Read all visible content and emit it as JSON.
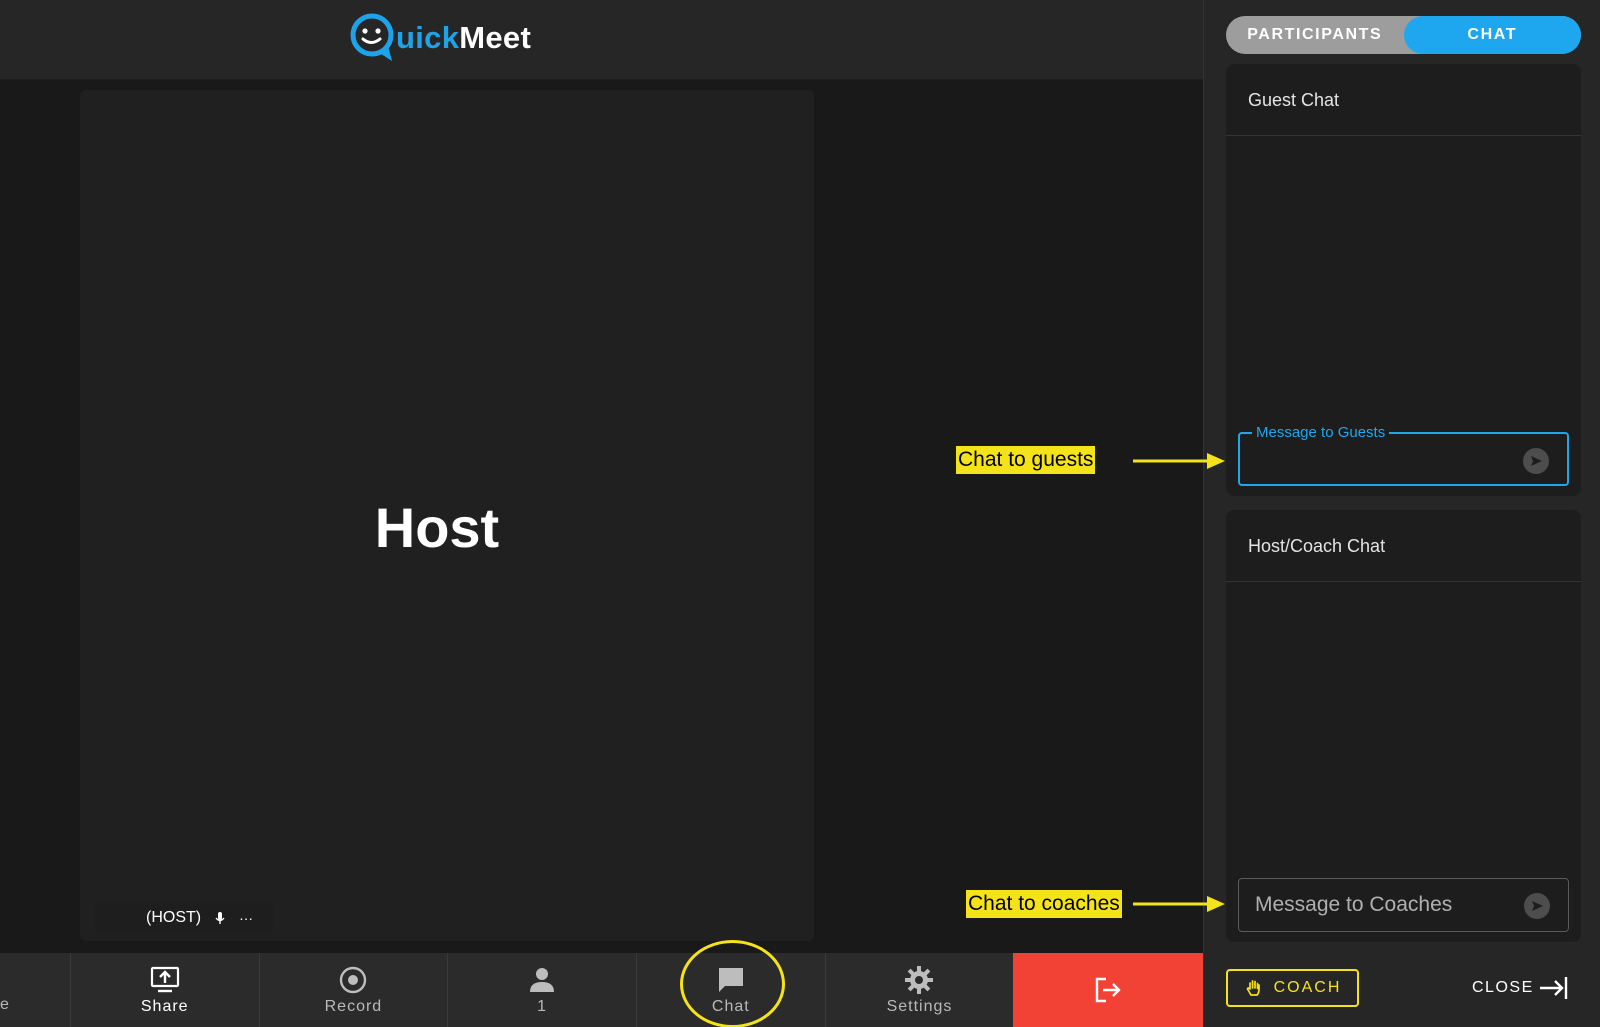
{
  "app": {
    "logo_q": "Q",
    "logo_accent": "uick",
    "logo_rest": "Meet"
  },
  "video": {
    "participant_name": "Host",
    "tile_label": "(HOST)",
    "more_glyph": "···"
  },
  "toolbar": {
    "stub_label": "e",
    "share_label": "Share",
    "record_label": "Record",
    "participants_count": "1",
    "chat_label": "Chat",
    "settings_label": "Settings"
  },
  "panel": {
    "tabs": [
      {
        "label": "PARTICIPANTS",
        "active": false
      },
      {
        "label": "CHAT",
        "active": true
      }
    ],
    "guest_chat": {
      "title": "Guest Chat",
      "field_legend": "Message to Guests",
      "field_value": ""
    },
    "coach_chat": {
      "title": "Host/Coach Chat",
      "field_placeholder": "Message to Coaches"
    },
    "coach_button": "COACH",
    "close_button": "CLOSE"
  },
  "annotations": {
    "guests": "Chat to guests",
    "coaches": "Chat to coaches"
  },
  "colors": {
    "accent": "#1ea7ef",
    "highlight": "#f5e31a",
    "leave": "#f24235",
    "panel_bg": "#262626",
    "main_bg": "#1a191a"
  }
}
